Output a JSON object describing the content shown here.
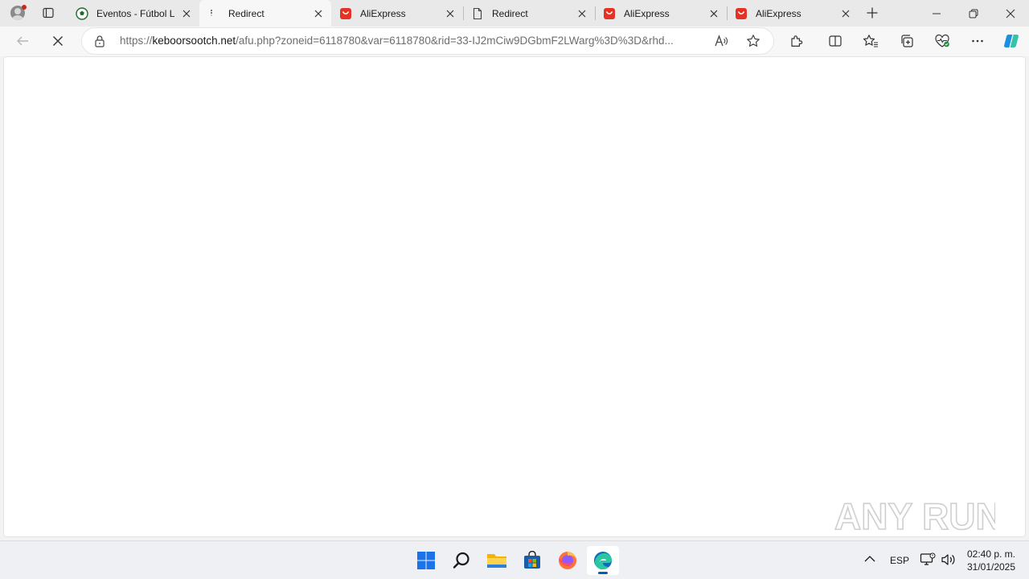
{
  "browser": {
    "tabs": [
      {
        "title": "Eventos - Fútbol Li",
        "icon": "soccer-ball-icon"
      },
      {
        "title": "Redirect",
        "icon": "loading-icon"
      },
      {
        "title": "AliExpress",
        "icon": "aliexpress-icon"
      },
      {
        "title": "Redirect",
        "icon": "page-icon"
      },
      {
        "title": "AliExpress",
        "icon": "aliexpress-icon"
      },
      {
        "title": "AliExpress",
        "icon": "aliexpress-icon"
      }
    ],
    "active_tab": 1,
    "address": {
      "scheme": "https://",
      "host": "keboorsootch.net",
      "path": "/afu.php?zoneid=6118780&var=6118780&rid=33-IJ2mCiw9DGbmF2LWarg%3D%3D&rhd..."
    }
  },
  "watermark": {
    "text": "ANY RUN"
  },
  "taskbar": {
    "language": "ESP",
    "time": "02:40 p. m.",
    "date": "31/01/2025"
  },
  "colors": {
    "aliexpress": "#e43225",
    "accent": "#005fb8",
    "edge_blue": "#0f6cbd"
  }
}
